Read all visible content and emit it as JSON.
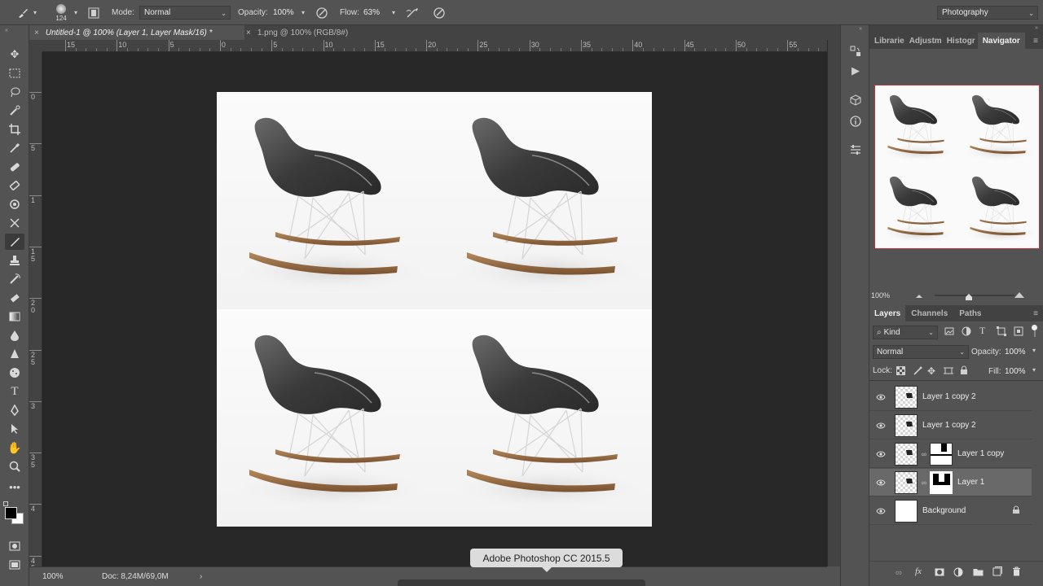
{
  "options_bar": {
    "brush_size": "124",
    "mode_label": "Mode:",
    "mode_value": "Normal",
    "opacity_label": "Opacity:",
    "opacity_value": "100%",
    "flow_label": "Flow:",
    "flow_value": "63%",
    "workspace": "Photography"
  },
  "tabs": [
    {
      "label": "Untitled-1 @ 100% (Layer 1, Layer Mask/16) *",
      "active": true
    },
    {
      "label": "1.png @ 100% (RGB/8#)",
      "active": false
    }
  ],
  "ruler": {
    "h_labels": [
      "15",
      "10",
      "5",
      "0",
      "5",
      "10",
      "15",
      "20",
      "25",
      "30",
      "35",
      "40",
      "45",
      "50",
      "55"
    ],
    "v_labels": [
      "0",
      "5",
      "1",
      "1 5",
      "2 0",
      "2 5",
      "3",
      "3 5",
      "4",
      "4 5"
    ]
  },
  "status": {
    "zoom": "100%",
    "doc": "Doc: 8,24M/69,0M"
  },
  "panel_tabs_top": [
    "Librarie",
    "Adjustm",
    "Histogr",
    "Navigator"
  ],
  "navigator": {
    "zoom": "100%"
  },
  "layers_tabs": [
    "Layers",
    "Channels",
    "Paths"
  ],
  "layers": {
    "filter_label": "Kind",
    "blend_mode": "Normal",
    "opacity_label": "Opacity:",
    "opacity_value": "100%",
    "lock_label": "Lock:",
    "fill_label": "Fill:",
    "fill_value": "100%",
    "items": [
      {
        "name": "Layer 1 copy 2",
        "mask": false,
        "selected": false
      },
      {
        "name": "Layer 1 copy 2",
        "mask": false,
        "selected": false
      },
      {
        "name": "Layer 1 copy",
        "mask": true,
        "selected": false
      },
      {
        "name": "Layer 1",
        "mask": true,
        "selected": true
      },
      {
        "name": "Background",
        "mask": false,
        "selected": false,
        "locked": true
      }
    ]
  },
  "tooltip": "Adobe Photoshop CC 2015.5",
  "colors": {
    "accent": "#c8303a",
    "panel": "#535353",
    "canvas_bg": "#282828"
  }
}
